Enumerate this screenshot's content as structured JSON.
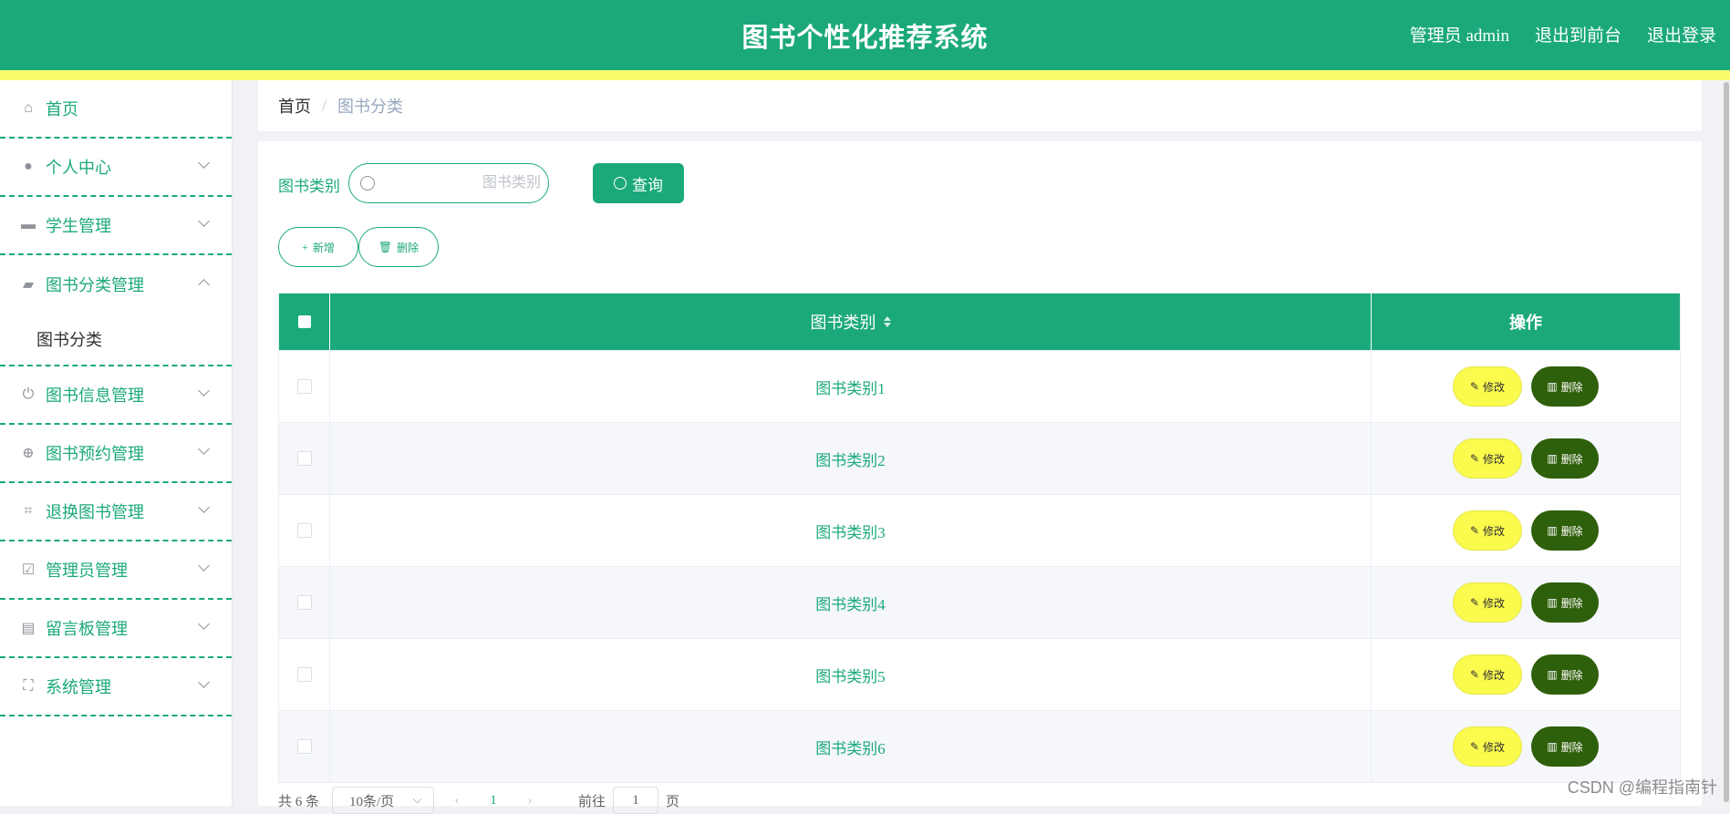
{
  "header": {
    "title": "图书个性化推荐系统",
    "admin_label": "管理员 admin",
    "front_label": "退出到前台",
    "logout_label": "退出登录"
  },
  "sidebar": {
    "items": [
      {
        "label": "首页",
        "icon": "home-icon"
      },
      {
        "label": "个人中心",
        "icon": "user-icon"
      },
      {
        "label": "学生管理",
        "icon": "chat-icon"
      },
      {
        "label": "图书分类管理",
        "icon": "ticket-icon"
      },
      {
        "label": "图书信息管理",
        "icon": "power-icon"
      },
      {
        "label": "图书预约管理",
        "icon": "crosshair-icon"
      },
      {
        "label": "退换图书管理",
        "icon": "crop-icon"
      },
      {
        "label": "管理员管理",
        "icon": "clipboard-icon"
      },
      {
        "label": "留言板管理",
        "icon": "briefcase-icon"
      },
      {
        "label": "系统管理",
        "icon": "fullscreen-icon"
      }
    ],
    "submenu": {
      "label": "图书分类"
    }
  },
  "breadcrumb": {
    "home": "首页",
    "separator": "/",
    "current": "图书分类"
  },
  "search": {
    "label": "图书类别",
    "placeholder": "图书类别",
    "button": "查询"
  },
  "actions": {
    "add": "新增",
    "delete": "删除"
  },
  "table": {
    "headers": {
      "category": "图书类别",
      "ops": "操作"
    },
    "rows": [
      {
        "category": "图书类别1"
      },
      {
        "category": "图书类别2"
      },
      {
        "category": "图书类别3"
      },
      {
        "category": "图书类别4"
      },
      {
        "category": "图书类别5"
      },
      {
        "category": "图书类别6"
      }
    ],
    "edit_label": "修改",
    "delete_label": "删除"
  },
  "pagination": {
    "total": "共 6 条",
    "page_size": "10条/页",
    "current_page": "1",
    "goto_label": "前往",
    "goto_value": "1",
    "page_suffix": "页"
  },
  "watermark": "CSDN @编程指南针",
  "colors": {
    "primary": "#1ba97c",
    "stripe": "#fbfb6e",
    "edit": "#fbfb4e",
    "delete": "#2e5f0a"
  }
}
